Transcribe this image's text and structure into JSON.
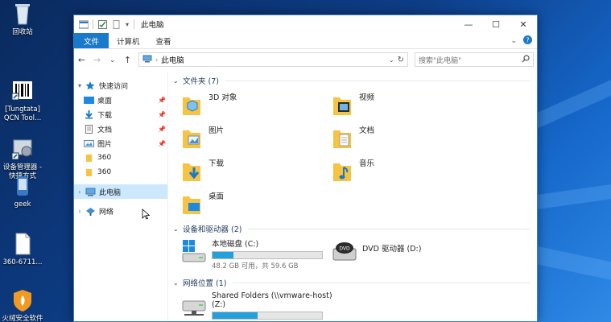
{
  "desktop": {
    "icons": [
      {
        "label": "回收站"
      },
      {
        "label": "[Tungtata]\nQCN Tool..."
      },
      {
        "label": "设备管理器 -\n快捷方式"
      },
      {
        "label": "geek"
      },
      {
        "label": "360-6711..."
      },
      {
        "label": "火绒安全软件"
      }
    ]
  },
  "window": {
    "title": "此电脑",
    "ribbon_tabs": [
      "文件",
      "计算机",
      "查看"
    ],
    "address": {
      "path": "此电脑"
    },
    "search": {
      "placeholder": "搜索\"此电脑\""
    }
  },
  "nav": {
    "quick_access": "快速访问",
    "items": [
      "桌面",
      "下载",
      "文档",
      "图片",
      "360",
      "360"
    ],
    "this_pc": "此电脑",
    "network": "网络"
  },
  "main": {
    "folders_header": "文件夹 (7)",
    "folders": [
      "3D 对象",
      "视频",
      "图片",
      "文档",
      "下载",
      "音乐",
      "桌面"
    ],
    "devices_header": "设备和驱动器 (2)",
    "drives": [
      {
        "name": "本地磁盘 (C:)",
        "size": "48.2 GB 可用，共 59.6 GB",
        "used_fraction": 0.19
      },
      {
        "name": "DVD 驱动器 (D:)",
        "size": "",
        "used_fraction": null
      }
    ],
    "network_header": "网络位置 (1)",
    "network_locations": [
      {
        "name": "Shared Folders (\\\\vmware-host)\n(Z:)",
        "used_fraction": 0.41
      }
    ]
  },
  "colors": {
    "accent": "#1979ca",
    "selection": "#cce8ff",
    "bar_fill": "#26a0da",
    "folder": "#f6c342"
  }
}
